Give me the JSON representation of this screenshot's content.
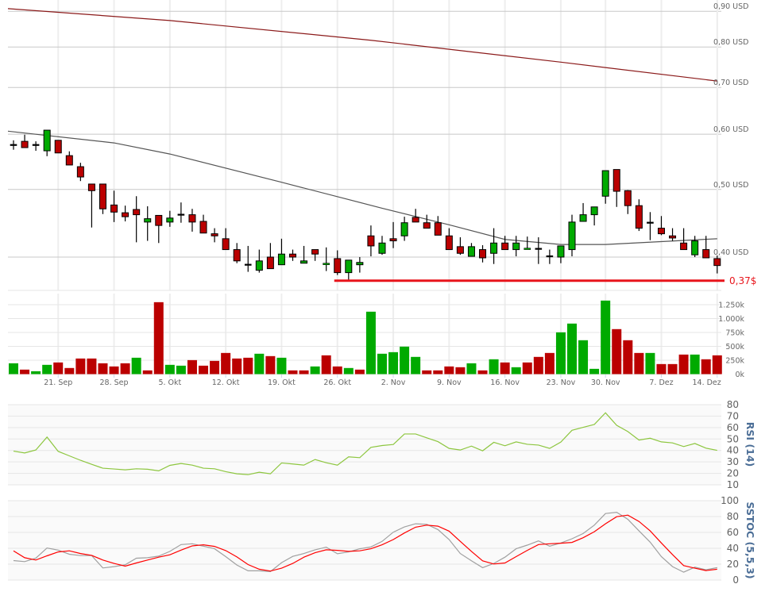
{
  "chart_data": {
    "type": "candlestick",
    "price_scale": "log",
    "price_axis": {
      "ticks": [
        {
          "value": 0.9,
          "label": "0,90 USD"
        },
        {
          "value": 0.8,
          "label": "0,80 USD"
        },
        {
          "value": 0.7,
          "label": "0,70 USD"
        },
        {
          "value": 0.6,
          "label": "0,60 USD"
        },
        {
          "value": 0.5,
          "label": "0,50 USD"
        },
        {
          "value": 0.4,
          "label": "0,40 USD"
        }
      ]
    },
    "dates": [
      "09-15",
      "09-16",
      "09-17",
      "09-18",
      "09-21",
      "09-22",
      "09-23",
      "09-24",
      "09-25",
      "09-28",
      "09-29",
      "09-30",
      "10-01",
      "10-02",
      "10-05",
      "10-06",
      "10-07",
      "10-08",
      "10-09",
      "10-12",
      "10-13",
      "10-14",
      "10-15",
      "10-16",
      "10-19",
      "10-20",
      "10-21",
      "10-22",
      "10-23",
      "10-26",
      "10-27",
      "10-28",
      "10-29",
      "10-30",
      "11-02",
      "11-03",
      "11-04",
      "11-05",
      "11-06",
      "11-09",
      "11-10",
      "11-11",
      "11-12",
      "11-13",
      "11-16",
      "11-17",
      "11-18",
      "11-19",
      "11-20",
      "11-23",
      "11-24",
      "11-25",
      "11-27",
      "11-30",
      "12-01",
      "12-02",
      "12-03",
      "12-04",
      "12-07",
      "12-08",
      "12-09",
      "12-10",
      "12-11",
      "12-14"
    ],
    "ohlc": [
      [
        0.579,
        0.588,
        0.57,
        0.579
      ],
      [
        0.586,
        0.599,
        0.574,
        0.574
      ],
      [
        0.579,
        0.586,
        0.568,
        0.579
      ],
      [
        0.568,
        0.608,
        0.558,
        0.608
      ],
      [
        0.588,
        0.588,
        0.564,
        0.564
      ],
      [
        0.559,
        0.567,
        0.542,
        0.542
      ],
      [
        0.539,
        0.546,
        0.514,
        0.521
      ],
      [
        0.509,
        0.509,
        0.441,
        0.498
      ],
      [
        0.509,
        0.509,
        0.461,
        0.469
      ],
      [
        0.475,
        0.498,
        0.449,
        0.464
      ],
      [
        0.463,
        0.474,
        0.45,
        0.457
      ],
      [
        0.468,
        0.489,
        0.42,
        0.46
      ],
      [
        0.449,
        0.473,
        0.422,
        0.454
      ],
      [
        0.459,
        0.459,
        0.419,
        0.444
      ],
      [
        0.449,
        0.466,
        0.442,
        0.455
      ],
      [
        0.46,
        0.479,
        0.448,
        0.46
      ],
      [
        0.46,
        0.469,
        0.435,
        0.449
      ],
      [
        0.45,
        0.46,
        0.433,
        0.433
      ],
      [
        0.432,
        0.44,
        0.42,
        0.429
      ],
      [
        0.425,
        0.44,
        0.41,
        0.41
      ],
      [
        0.41,
        0.419,
        0.392,
        0.395
      ],
      [
        0.39,
        0.415,
        0.381,
        0.39
      ],
      [
        0.383,
        0.41,
        0.38,
        0.395
      ],
      [
        0.4,
        0.419,
        0.385,
        0.385
      ],
      [
        0.39,
        0.425,
        0.39,
        0.404
      ],
      [
        0.404,
        0.41,
        0.395,
        0.4
      ],
      [
        0.392,
        0.415,
        0.392,
        0.395
      ],
      [
        0.41,
        0.41,
        0.395,
        0.404
      ],
      [
        0.39,
        0.413,
        0.382,
        0.392
      ],
      [
        0.398,
        0.409,
        0.377,
        0.38
      ],
      [
        0.38,
        0.396,
        0.37,
        0.396
      ],
      [
        0.39,
        0.4,
        0.38,
        0.393
      ],
      [
        0.429,
        0.444,
        0.401,
        0.415
      ],
      [
        0.405,
        0.429,
        0.403,
        0.419
      ],
      [
        0.425,
        0.449,
        0.412,
        0.422
      ],
      [
        0.429,
        0.457,
        0.422,
        0.448
      ],
      [
        0.456,
        0.469,
        0.449,
        0.449
      ],
      [
        0.448,
        0.46,
        0.44,
        0.44
      ],
      [
        0.448,
        0.458,
        0.43,
        0.43
      ],
      [
        0.429,
        0.44,
        0.41,
        0.41
      ],
      [
        0.414,
        0.427,
        0.403,
        0.405
      ],
      [
        0.401,
        0.419,
        0.401,
        0.414
      ],
      [
        0.41,
        0.416,
        0.393,
        0.399
      ],
      [
        0.405,
        0.44,
        0.391,
        0.419
      ],
      [
        0.419,
        0.429,
        0.41,
        0.41
      ],
      [
        0.41,
        0.429,
        0.401,
        0.419
      ],
      [
        0.41,
        0.428,
        0.41,
        0.412
      ],
      [
        0.411,
        0.427,
        0.391,
        0.411
      ],
      [
        0.401,
        0.41,
        0.391,
        0.401
      ],
      [
        0.4,
        0.415,
        0.392,
        0.415
      ],
      [
        0.41,
        0.46,
        0.401,
        0.449
      ],
      [
        0.45,
        0.478,
        0.45,
        0.46
      ],
      [
        0.46,
        0.472,
        0.444,
        0.472
      ],
      [
        0.489,
        0.532,
        0.477,
        0.532
      ],
      [
        0.534,
        0.534,
        0.472,
        0.497
      ],
      [
        0.498,
        0.499,
        0.461,
        0.474
      ],
      [
        0.474,
        0.484,
        0.436,
        0.44
      ],
      [
        0.448,
        0.464,
        0.423,
        0.448
      ],
      [
        0.44,
        0.458,
        0.43,
        0.432
      ],
      [
        0.429,
        0.44,
        0.422,
        0.426
      ],
      [
        0.419,
        0.44,
        0.41,
        0.41
      ],
      [
        0.403,
        0.429,
        0.4,
        0.422
      ],
      [
        0.41,
        0.429,
        0.399,
        0.399
      ],
      [
        0.398,
        0.402,
        0.379,
        0.389
      ]
    ],
    "moving_averages": [
      {
        "color": "#8b1a1a",
        "points": [
          [
            "09-15",
            0.908
          ],
          [
            "10-05",
            0.873
          ],
          [
            "10-29",
            0.818
          ],
          [
            "11-23",
            0.761
          ],
          [
            "12-14",
            0.715
          ]
        ]
      },
      {
        "color": "#555555",
        "points": [
          [
            "09-15",
            0.606
          ],
          [
            "09-28",
            0.583
          ],
          [
            "10-05",
            0.562
          ],
          [
            "10-19",
            0.512
          ],
          [
            "10-30",
            0.47
          ],
          [
            "11-09",
            0.445
          ],
          [
            "11-16",
            0.424
          ],
          [
            "11-23",
            0.417
          ],
          [
            "11-30",
            0.417
          ],
          [
            "12-14",
            0.425
          ]
        ]
      }
    ],
    "support_line": {
      "value": 0.37,
      "from": "10-26",
      "label": "0,37$",
      "color": "#e8141b"
    },
    "volume": {
      "values": [
        195000,
        81000,
        52000,
        167000,
        210000,
        110000,
        281000,
        281000,
        195000,
        138000,
        195000,
        295000,
        67000,
        1295000,
        167000,
        152000,
        252000,
        152000,
        238000,
        381000,
        281000,
        295000,
        367000,
        324000,
        295000,
        67000,
        67000,
        138000,
        338000,
        138000,
        110000,
        81000,
        1124000,
        367000,
        395000,
        495000,
        310000,
        67000,
        67000,
        138000,
        124000,
        195000,
        67000,
        267000,
        210000,
        124000,
        210000,
        310000,
        381000,
        752000,
        910000,
        610000,
        95000,
        1324000,
        810000,
        610000,
        381000,
        381000,
        181000,
        181000,
        352000,
        352000,
        267000,
        338000
      ],
      "direction": [
        "up",
        "down",
        "up",
        "up",
        "down",
        "down",
        "down",
        "down",
        "down",
        "down",
        "down",
        "up",
        "down",
        "down",
        "up",
        "up",
        "down",
        "down",
        "down",
        "down",
        "down",
        "down",
        "up",
        "down",
        "up",
        "down",
        "down",
        "up",
        "down",
        "down",
        "up",
        "down",
        "up",
        "up",
        "up",
        "up",
        "up",
        "down",
        "down",
        "down",
        "down",
        "up",
        "down",
        "up",
        "down",
        "up",
        "down",
        "down",
        "down",
        "up",
        "up",
        "up",
        "up",
        "up",
        "down",
        "down",
        "down",
        "up",
        "down",
        "down",
        "down",
        "up",
        "down",
        "down"
      ],
      "ticks": [
        {
          "value": 1250000,
          "label": "1.250k"
        },
        {
          "value": 1000000,
          "label": "1.000k"
        },
        {
          "value": 750000,
          "label": "750k"
        },
        {
          "value": 500000,
          "label": "500k"
        },
        {
          "value": 250000,
          "label": "250k"
        },
        {
          "value": 0,
          "label": "0k"
        }
      ]
    },
    "x_ticks": [
      {
        "date": "09-21",
        "label": "21. Sep"
      },
      {
        "date": "09-28",
        "label": "28. Sep"
      },
      {
        "date": "10-05",
        "label": "5. Okt"
      },
      {
        "date": "10-12",
        "label": "12. Okt"
      },
      {
        "date": "10-19",
        "label": "19. Okt"
      },
      {
        "date": "10-26",
        "label": "26. Okt"
      },
      {
        "date": "11-02",
        "label": "2. Nov"
      },
      {
        "date": "11-09",
        "label": "9. Nov"
      },
      {
        "date": "11-16",
        "label": "16. Nov"
      },
      {
        "date": "11-23",
        "label": "23. Nov"
      },
      {
        "date": "11-30",
        "label": "30. Nov"
      },
      {
        "date": "12-07",
        "label": "7. Dez"
      },
      {
        "date": "12-14",
        "label": "14. Dez"
      }
    ],
    "rsi": {
      "title": "RSI (14)",
      "color": "#8dc63f",
      "ticks": [
        80,
        70,
        60,
        50,
        40,
        30,
        20,
        10
      ],
      "range": [
        10,
        80
      ],
      "values": [
        39.4,
        37.8,
        40.4,
        51.7,
        39.2,
        35.3,
        31.4,
        27.9,
        24.5,
        23.8,
        23.1,
        24.0,
        23.6,
        22.2,
        27.0,
        28.6,
        27.2,
        24.5,
        24.0,
        21.5,
        19.6,
        18.9,
        21.0,
        19.6,
        29.1,
        28.2,
        27.2,
        32.1,
        29.3,
        27.2,
        34.4,
        33.7,
        42.7,
        44.3,
        45.2,
        54.4,
        54.4,
        51.0,
        47.7,
        41.8,
        40.4,
        43.8,
        39.7,
        47.1,
        44.1,
        47.5,
        45.4,
        44.7,
        41.8,
        47.3,
        57.6,
        60.2,
        62.7,
        72.9,
        62.0,
        56.5,
        49.1,
        50.7,
        47.5,
        46.6,
        43.4,
        46.1,
        42.0,
        40.1
      ]
    },
    "sstoc": {
      "title": "SSTOC (5,5,3)",
      "ticks": [
        100,
        80,
        60,
        40,
        20,
        0
      ],
      "range": [
        0,
        100
      ],
      "k_color": "#a0a0a0",
      "d_color": "#ff0000",
      "k": [
        24.5,
        23.2,
        27.5,
        40.4,
        37.7,
        32.5,
        30.8,
        30.8,
        15.2,
        16.9,
        19.2,
        27.5,
        28.1,
        30.1,
        36.1,
        44.7,
        45.7,
        42.7,
        39.4,
        29.5,
        18.9,
        11.6,
        11.6,
        10.6,
        21.9,
        29.8,
        33.4,
        38.1,
        41.4,
        33.1,
        35.4,
        39.4,
        41.7,
        48.7,
        60.3,
        66.9,
        70.9,
        70.2,
        63.6,
        51.0,
        33.4,
        24.2,
        15.6,
        20.9,
        28.8,
        39.4,
        44.0,
        49.3,
        42.7,
        46.7,
        52.0,
        58.6,
        69.2,
        83.8,
        85.4,
        76.5,
        61.9,
        47.7,
        29.5,
        16.9,
        9.9,
        16.2,
        12.9,
        15.6
      ],
      "d": [
        36.8,
        28.1,
        25.2,
        30.5,
        35.4,
        36.8,
        33.4,
        31.1,
        25.2,
        20.9,
        17.5,
        21.5,
        25.2,
        28.8,
        31.8,
        37.7,
        43.0,
        44.4,
        42.4,
        37.1,
        29.1,
        19.5,
        13.6,
        11.3,
        14.9,
        20.9,
        28.8,
        34.4,
        38.1,
        37.4,
        36.1,
        36.8,
        39.4,
        44.4,
        51.0,
        59.3,
        66.6,
        69.2,
        67.9,
        61.6,
        48.7,
        36.1,
        24.2,
        20.2,
        21.5,
        29.5,
        37.4,
        44.7,
        45.7,
        46.4,
        47.4,
        53.3,
        60.9,
        70.9,
        79.8,
        81.8,
        73.8,
        61.9,
        46.7,
        32.1,
        18.2,
        14.9,
        11.9,
        13.6
      ]
    },
    "colors": {
      "up": "#00aa00",
      "down": "#bb0000",
      "grid": "#c8c8c8",
      "vgrid": "#eeeeee",
      "panel_bg": "#fafafa"
    }
  }
}
